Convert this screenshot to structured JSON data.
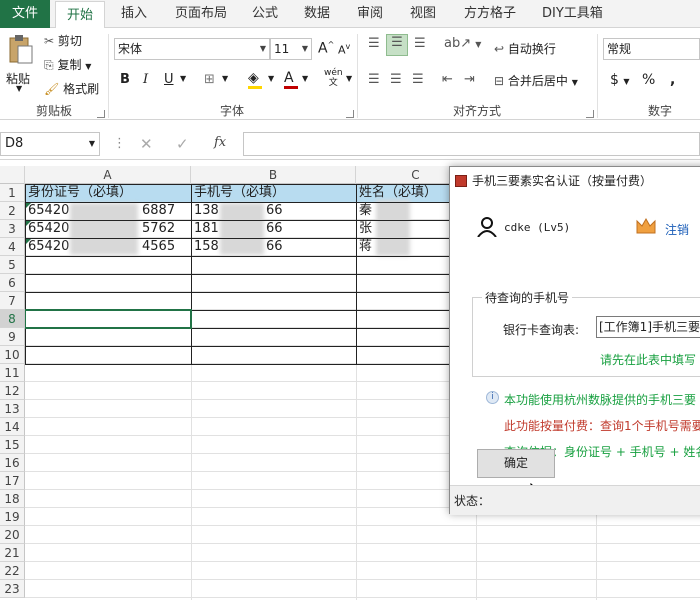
{
  "tabs": {
    "file": "文件",
    "home": "开始",
    "insert": "插入",
    "layout": "页面布局",
    "formula": "公式",
    "data": "数据",
    "review": "审阅",
    "view": "视图",
    "fangfang": "方方格子",
    "diy": "DIY工具箱"
  },
  "clipboard": {
    "paste": "粘贴",
    "cut": "剪切",
    "copy": "复制",
    "painter": "格式刷",
    "label": "剪贴板"
  },
  "font": {
    "name": "宋体",
    "size": "11",
    "bold": "B",
    "italic": "I",
    "underline": "U",
    "label": "字体",
    "wen": "wén"
  },
  "alignment": {
    "wrap": "自动换行",
    "merge": "合并后居中",
    "label": "对齐方式"
  },
  "number": {
    "format": "常规",
    "currency": "$",
    "percent": "%",
    "comma": ",",
    "label": "数字"
  },
  "formula_bar": {
    "cell": "D8",
    "fx": "fx"
  },
  "columns": [
    "A",
    "B",
    "C"
  ],
  "rows": [
    "1",
    "2",
    "3",
    "4",
    "5",
    "6",
    "7",
    "8",
    "9",
    "10",
    "11",
    "12",
    "13",
    "14",
    "15",
    "16",
    "17",
    "18",
    "19",
    "20",
    "21",
    "22",
    "23"
  ],
  "table": {
    "headers": [
      "身份证号（必填）",
      "手机号（必填）",
      "姓名（必填）"
    ],
    "rows": [
      [
        "65420",
        "6887",
        "138",
        "66",
        "秦"
      ],
      [
        "65420",
        "5762",
        "181",
        "66",
        "张"
      ],
      [
        "65420",
        "4565",
        "158",
        "66",
        "蒋"
      ]
    ]
  },
  "dialog": {
    "title": "手机三要素实名认证（按量付费）",
    "user": "cdke (Lv5)",
    "logout": "注销",
    "group": "待查询的手机号",
    "field_label": "银行卡查询表:",
    "field_value": "[工作簿1]手机三要",
    "hint": "请先在此表中填写",
    "info1": "本功能使用杭州数脉提供的手机三要",
    "info2": "此功能按量付费：查询1个手机号需要",
    "info3": "查询依据：身份证号 + 手机号 + 姓名",
    "ok": "确定",
    "status": "状态："
  }
}
